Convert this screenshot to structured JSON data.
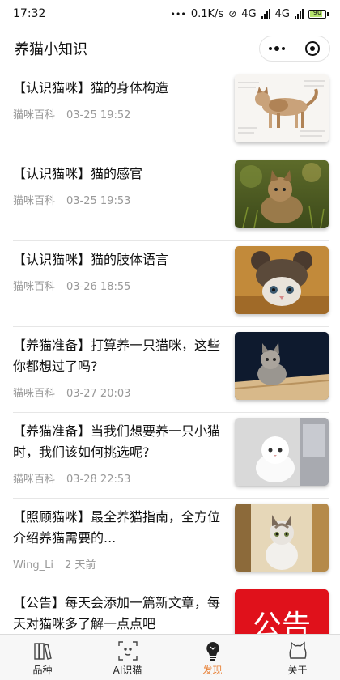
{
  "status": {
    "time": "17:32",
    "more": "•••",
    "speed": "0.1K/s",
    "net1": "4G",
    "net2": "4G",
    "battery": "90"
  },
  "nav": {
    "title": "养猫小知识"
  },
  "articles": [
    {
      "title": "【认识猫咪】猫的身体构造",
      "source": "猫咪百科",
      "date": "03-25 19:52",
      "image": "cat-anatomy-diagram"
    },
    {
      "title": "【认识猫咪】猫的感官",
      "source": "猫咪百科",
      "date": "03-25 19:53",
      "image": "kitten-in-grass"
    },
    {
      "title": "【认识猫咪】猫的肢体语言",
      "source": "猫咪百科",
      "date": "03-26 18:55",
      "image": "cat-in-knit-hat"
    },
    {
      "title": "【养猫准备】打算养一只猫咪，这些你都想过了吗?",
      "source": "猫咪百科",
      "date": "03-27 20:03",
      "image": "tabby-kitten-on-rug"
    },
    {
      "title": "【养猫准备】当我们想要养一只小猫时，我们该如何挑选呢?",
      "source": "猫咪百科",
      "date": "03-28 22:53",
      "image": "white-persian-kitten"
    },
    {
      "title": "【照顾猫咪】最全养猫指南，全方位介绍养猫需要的...",
      "source": "Wing_Li",
      "date": "2 天前",
      "image": "sitting-kitten"
    },
    {
      "title": "【公告】每天会添加一篇新文章，每天对猫咪多了解一点点吧",
      "source": "",
      "date": "",
      "image": "notice-banner",
      "badge": "公告"
    }
  ],
  "tabs": [
    {
      "label": "品种",
      "icon": "books-icon"
    },
    {
      "label": "AI识猫",
      "icon": "scan-cat-icon"
    },
    {
      "label": "发现",
      "icon": "bulb-icon",
      "active": true
    },
    {
      "label": "关于",
      "icon": "cat-head-icon"
    }
  ],
  "colors": {
    "accent": "#e8833a",
    "notice": "#e0111b"
  }
}
